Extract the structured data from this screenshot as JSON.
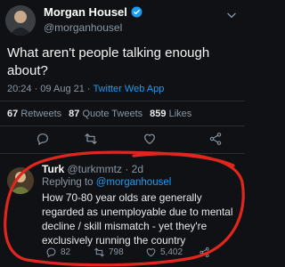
{
  "tweet": {
    "author_name": "Morgan Housel",
    "author_handle": "@morganhousel",
    "text": "What aren't people talking enough about?",
    "time": "20:24 · 09 Aug 21 · ",
    "app": "Twitter Web App",
    "retweets_count": "67",
    "retweets_label": "Retweets",
    "quote_count": "87",
    "quote_label": "Quote Tweets",
    "likes_count": "859",
    "likes_label": "Likes"
  },
  "reply": {
    "author_name": "Turk",
    "author_handle": "@turkmmtz · 2d",
    "replying_prefix": "Replying to ",
    "replying_to": "@morganhousel",
    "text": "How 70-80 year olds are generally regarded as unemployable due to mental decline / skill mismatch - yet they're exclusively running the country",
    "reply_count": "82",
    "retweet_count": "798",
    "like_count": "5,402"
  },
  "colors": {
    "background": "#101114",
    "accent": "#1d9bf0",
    "muted": "#8b98a5",
    "annotation": "#e0261d"
  }
}
